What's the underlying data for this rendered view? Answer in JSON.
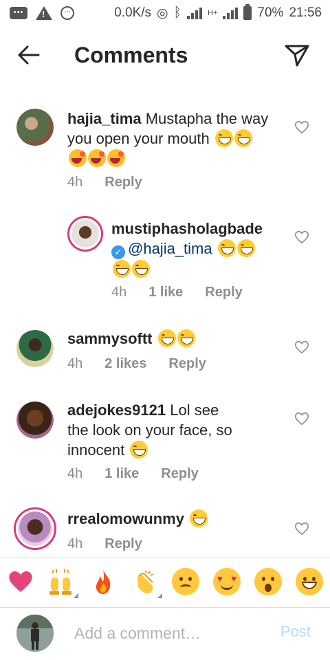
{
  "status_bar": {
    "network_speed": "0.0K/s",
    "network_type": "H+",
    "battery": "70%",
    "time": "21:56"
  },
  "header": {
    "title": "Comments",
    "back_icon": "arrow-left-icon",
    "send_icon": "paper-plane-icon"
  },
  "comments": [
    {
      "username": "hajia_tima",
      "text": "Mustapha the way you open your mouth",
      "emojis": [
        "grin",
        "grin",
        "laugh",
        "laugh",
        "laugh"
      ],
      "time": "4h",
      "likes": "",
      "reply": "Reply"
    },
    {
      "username": "mustiphasholagbade",
      "mention": "@hajia_tima",
      "verified": true,
      "emojis": [
        "grin",
        "grin",
        "grin",
        "grin"
      ],
      "time": "4h",
      "likes": "1 like",
      "reply": "Reply"
    },
    {
      "username": "sammysoftt",
      "text": "",
      "emojis": [
        "grin",
        "grin"
      ],
      "time": "4h",
      "likes": "2 likes",
      "reply": "Reply"
    },
    {
      "username": "adejokes9121",
      "text_line1": "Lol see",
      "text_line2": "the look on your face, so",
      "text_line3": "innocent",
      "emojis": [
        "grin"
      ],
      "time": "4h",
      "likes": "1 like",
      "reply": "Reply"
    },
    {
      "username": "rrealomowunmy",
      "text": "",
      "emojis": [
        "grin"
      ],
      "time": "4h",
      "likes": "",
      "reply": "Reply"
    }
  ],
  "emoji_bar": [
    "red-heart",
    "raising-hands",
    "fire",
    "clapping-hands",
    "sad-face",
    "heart-eyes-face",
    "surprised-face",
    "grinning-face"
  ],
  "comment_input": {
    "placeholder": "Add a comment…",
    "post_label": "Post"
  }
}
